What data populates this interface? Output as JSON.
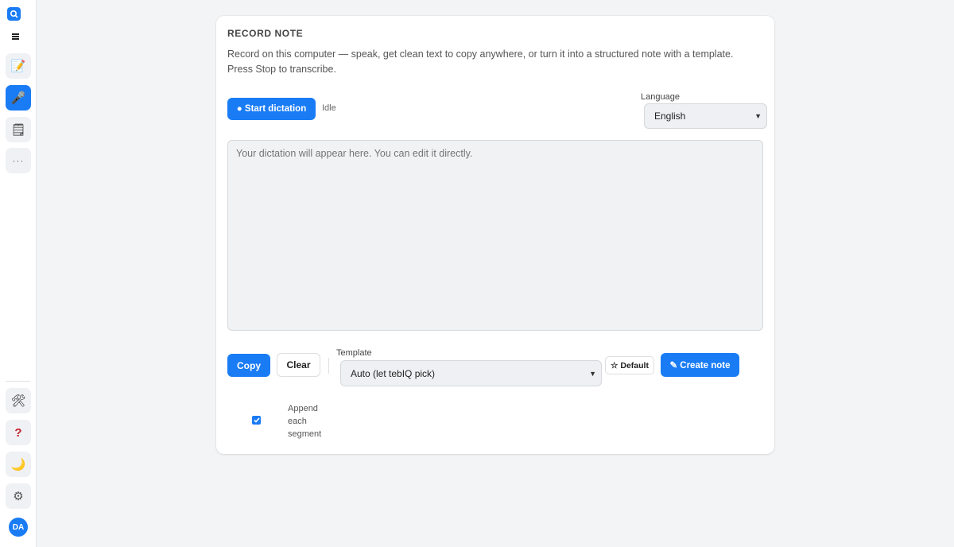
{
  "sidebar": {
    "logo_icon": "search-logo-icon",
    "menu_icon": "hamburger-icon",
    "items": [
      {
        "name": "notes",
        "icon": "memo-icon",
        "glyph": "📝",
        "active": false
      },
      {
        "name": "record",
        "icon": "microphone-icon",
        "glyph": "🎤",
        "active": true
      },
      {
        "name": "calendar",
        "icon": "notepad-icon",
        "glyph": "🗒",
        "active": false
      },
      {
        "name": "more",
        "icon": "more-dots-icon",
        "glyph": "···",
        "active": false
      }
    ],
    "bottom_items": [
      {
        "name": "tools",
        "icon": "tools-icon",
        "glyph": "🛠"
      },
      {
        "name": "help",
        "icon": "question-icon",
        "glyph": "?"
      },
      {
        "name": "theme",
        "icon": "moon-icon",
        "glyph": "🌙"
      },
      {
        "name": "settings",
        "icon": "gear-icon",
        "glyph": "⚙"
      }
    ],
    "avatar_initials": "DA"
  },
  "card": {
    "title": "RECORD NOTE",
    "description": "Record on this computer — speak, get clean text to copy anywhere, or turn it into a structured note with a template. Press Stop to transcribe.",
    "start_label": "● Start dictation",
    "status": "Idle",
    "language_label": "Language",
    "language_value": "English",
    "dictation_placeholder": "Your dictation will appear here. You can edit it directly.",
    "copy_label": "Copy",
    "clear_label": "Clear",
    "template_label": "Template",
    "template_value": "Auto (let tebIQ pick)",
    "default_label": "☆ Default",
    "create_label": "✎ Create note",
    "append_label": "Append each segment",
    "append_checked": true
  },
  "colors": {
    "accent": "#1a7cf5",
    "background": "#f3f4f6",
    "card": "#ffffff"
  }
}
